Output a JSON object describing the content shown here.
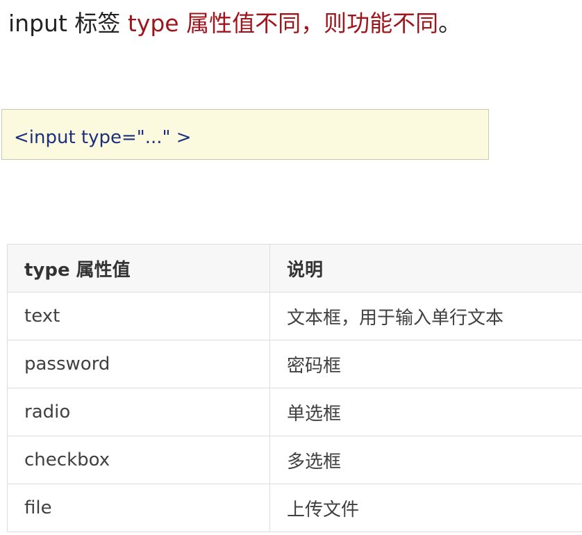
{
  "heading": {
    "prefix": "input 标签 ",
    "highlight": "type 属性值不同，则功能不同",
    "suffix": "。"
  },
  "code": {
    "text": "<input type=\"...\" >"
  },
  "table": {
    "headers": [
      "type 属性值",
      "说明"
    ],
    "rows": [
      [
        "text",
        "文本框，用于输入单行文本"
      ],
      [
        "password",
        "密码框"
      ],
      [
        "radio",
        "单选框"
      ],
      [
        "checkbox",
        "多选框"
      ],
      [
        "file",
        "上传文件"
      ]
    ]
  },
  "colors": {
    "highlight": "#a0141b",
    "code_text": "#1c2f7d",
    "code_background": "#fbfadf",
    "table_header_background": "#f7f7f7",
    "table_border": "#dddddd"
  }
}
